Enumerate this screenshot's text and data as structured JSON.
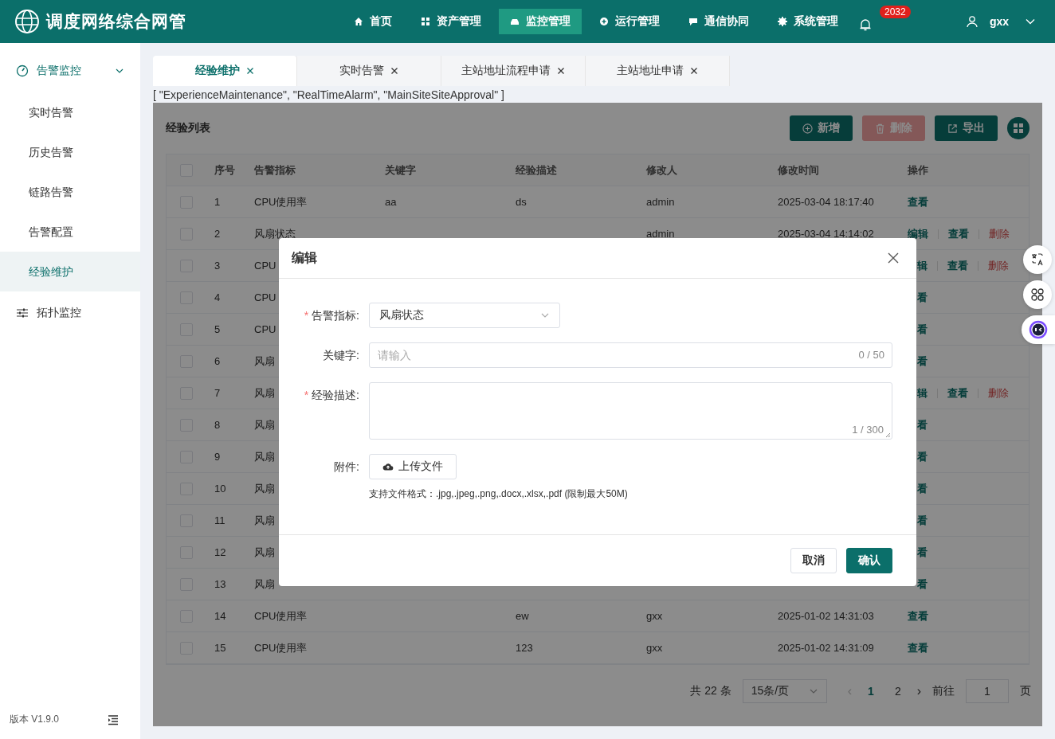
{
  "app": {
    "title": "调度网络综合网管"
  },
  "nav": [
    {
      "label": "首页",
      "kind": "home",
      "selected": false
    },
    {
      "label": "资产管理",
      "kind": "grid",
      "selected": false
    },
    {
      "label": "监控管理",
      "kind": "car",
      "selected": true
    },
    {
      "label": "运行管理",
      "kind": "plus",
      "selected": false
    },
    {
      "label": "通信协同",
      "kind": "chat",
      "selected": false
    },
    {
      "label": "系统管理",
      "kind": "gear",
      "selected": false
    }
  ],
  "notifications": {
    "badge": "2032"
  },
  "user": {
    "name": "gxx"
  },
  "sidebar": {
    "groups": [
      {
        "label": "告警监控",
        "kind": "gauge",
        "expanded": true,
        "children": [
          {
            "label": "实时告警",
            "selected": false
          },
          {
            "label": "历史告警",
            "selected": false
          },
          {
            "label": "链路告警",
            "selected": false
          },
          {
            "label": "告警配置",
            "selected": false
          },
          {
            "label": "经验维护",
            "selected": true
          }
        ]
      },
      {
        "label": "拓扑监控",
        "kind": "sliders",
        "expanded": false
      }
    ],
    "version": "版本 V1.9.0"
  },
  "tabs": [
    {
      "label": "经验维护",
      "selected": true
    },
    {
      "label": "实时告警",
      "selected": false
    },
    {
      "label": "主站地址流程申请",
      "selected": false
    },
    {
      "label": "主站地址申请",
      "selected": false
    }
  ],
  "cached_views": "[ \"ExperienceMaintenance\", \"RealTimeAlarm\", \"MainSiteSiteApproval\" ]",
  "table_card": {
    "title": "经验列表",
    "buttons": [
      {
        "label": "新增",
        "kind": "add",
        "disabled": false
      },
      {
        "label": "删除",
        "kind": "delete",
        "disabled": true
      },
      {
        "label": "导出",
        "kind": "export",
        "disabled": false
      }
    ],
    "all_checked": false,
    "columns": [
      "序号",
      "告警指标",
      "关键字",
      "经验描述",
      "修改人",
      "修改时间",
      "操作"
    ],
    "rows": [
      {
        "checked": false,
        "covered": false,
        "seq": "1",
        "indicator": "CPU使用率",
        "keyword": "aa",
        "description": "ds",
        "modifier": "admin",
        "time": "2025-03-04 18:17:40",
        "actions": [
          {
            "label": "查看",
            "kind": "view"
          }
        ]
      },
      {
        "checked": false,
        "covered": false,
        "seq": "2",
        "indicator": "风扇状态",
        "modifier": "admin",
        "time": "2025-03-04 14:14:02",
        "actions": [
          {
            "label": "编辑",
            "kind": "edit"
          },
          {
            "label": "查看",
            "kind": "view"
          },
          {
            "label": "删除",
            "kind": "delete"
          }
        ]
      },
      {
        "checked": false,
        "covered": true,
        "seq": "3",
        "indicator": "CPU",
        "actions": [
          {
            "label": "辑",
            "kind": "edit"
          },
          {
            "label": "查看",
            "kind": "view"
          },
          {
            "label": "删除",
            "kind": "delete"
          }
        ]
      },
      {
        "checked": false,
        "covered": true,
        "seq": "4",
        "indicator": "CPU",
        "actions": [
          {
            "label": "看",
            "kind": "view"
          }
        ]
      },
      {
        "checked": false,
        "covered": true,
        "seq": "5",
        "indicator": "CPU",
        "actions": [
          {
            "label": "看",
            "kind": "view"
          }
        ]
      },
      {
        "checked": false,
        "covered": true,
        "seq": "6",
        "indicator": "风扇",
        "actions": [
          {
            "label": "看",
            "kind": "view"
          }
        ]
      },
      {
        "checked": false,
        "covered": true,
        "seq": "7",
        "indicator": "风扇",
        "actions": [
          {
            "label": "辑",
            "kind": "edit"
          },
          {
            "label": "查看",
            "kind": "view"
          },
          {
            "label": "删除",
            "kind": "delete"
          }
        ]
      },
      {
        "checked": false,
        "covered": true,
        "seq": "8",
        "indicator": "风扇",
        "actions": [
          {
            "label": "看",
            "kind": "view"
          }
        ]
      },
      {
        "checked": false,
        "covered": true,
        "seq": "9",
        "indicator": "风扇",
        "actions": [
          {
            "label": "看",
            "kind": "view"
          }
        ]
      },
      {
        "checked": false,
        "covered": true,
        "seq": "10",
        "indicator": "风扇",
        "actions": [
          {
            "label": "看",
            "kind": "view"
          }
        ]
      },
      {
        "checked": false,
        "covered": true,
        "seq": "11",
        "indicator": "风扇",
        "actions": [
          {
            "label": "看",
            "kind": "view"
          }
        ]
      },
      {
        "checked": false,
        "covered": true,
        "seq": "12",
        "indicator": "风扇",
        "actions": [
          {
            "label": "看",
            "kind": "view"
          }
        ]
      },
      {
        "checked": false,
        "covered": true,
        "seq": "13",
        "indicator": "风扇",
        "actions": [
          {
            "label": "看",
            "kind": "view"
          }
        ]
      },
      {
        "checked": false,
        "covered": false,
        "seq": "14",
        "indicator": "CPU使用率",
        "description": "ew",
        "modifier": "gxx",
        "time": "2025-01-02 14:31:03",
        "actions": [
          {
            "label": "查看",
            "kind": "view"
          }
        ]
      },
      {
        "checked": false,
        "covered": false,
        "seq": "15",
        "indicator": "CPU使用率",
        "description": "123",
        "modifier": "gxx",
        "time": "2025-01-02 14:31:09",
        "actions": [
          {
            "label": "查看",
            "kind": "view"
          }
        ]
      }
    ],
    "pagination": {
      "total": "共 22 条",
      "page_size": "15条/页",
      "prev": "‹",
      "pages": [
        {
          "label": "1",
          "selected": true
        },
        {
          "label": "2",
          "selected": false
        }
      ],
      "next": "›",
      "goto_label": "前往",
      "goto_value": "1",
      "page_suffix": "页"
    }
  },
  "dialog": {
    "title": "编辑",
    "required_mark": "*",
    "fields": [
      {
        "kind": "select",
        "label": "告警指标:",
        "required": true,
        "value": "风扇状态"
      },
      {
        "kind": "input",
        "label": "关键字:",
        "required": false,
        "placeholder": "请输入",
        "counter": "0 / 50"
      },
      {
        "kind": "textarea",
        "label": "经验描述:",
        "required": true,
        "counter": "1 / 300"
      },
      {
        "kind": "upload",
        "label": "附件:",
        "required": false,
        "button": "上传文件",
        "hint": "支持文件格式：.jpg,.jpeg,.png,.docx,.xlsx,.pdf (限制最大50M)"
      }
    ],
    "buttons": [
      {
        "label": "取消",
        "kind": "cancel"
      },
      {
        "label": "确认",
        "kind": "confirm"
      }
    ]
  }
}
